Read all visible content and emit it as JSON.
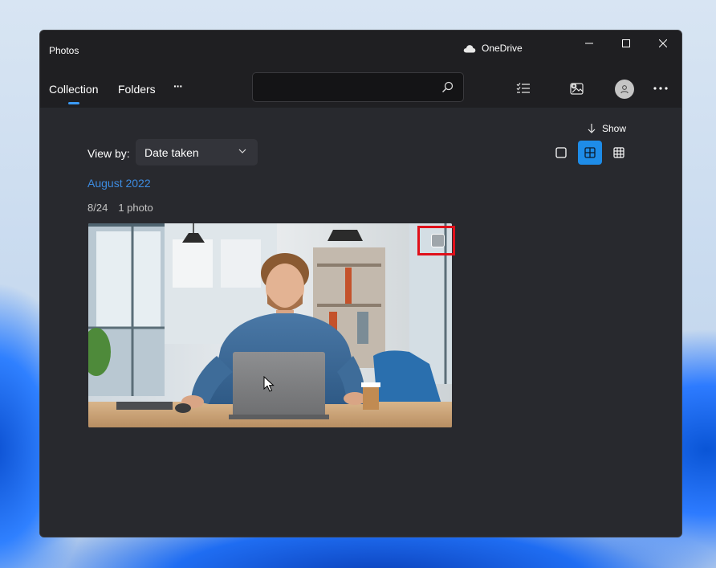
{
  "window": {
    "title": "Photos",
    "onedrive_label": "OneDrive"
  },
  "nav": {
    "collection": "Collection",
    "folders": "Folders",
    "more": "···"
  },
  "search": {
    "value": "",
    "placeholder": ""
  },
  "toolbar_icons": [
    "filter-list-icon",
    "import-icon",
    "account-icon",
    "more-icon"
  ],
  "content": {
    "show_label": "Show",
    "view_by_label": "View by:",
    "view_by_value": "Date taken",
    "view_modes": [
      "single-square-icon",
      "medium-grid-icon",
      "small-grid-icon"
    ],
    "active_view_mode": "medium-grid-icon",
    "month_header": "August 2022",
    "day_label": "8/24",
    "count_label": "1 photo"
  },
  "colors": {
    "accent": "#1e8ce8",
    "month_link": "#3d8be0",
    "highlight": "#e0101a"
  }
}
